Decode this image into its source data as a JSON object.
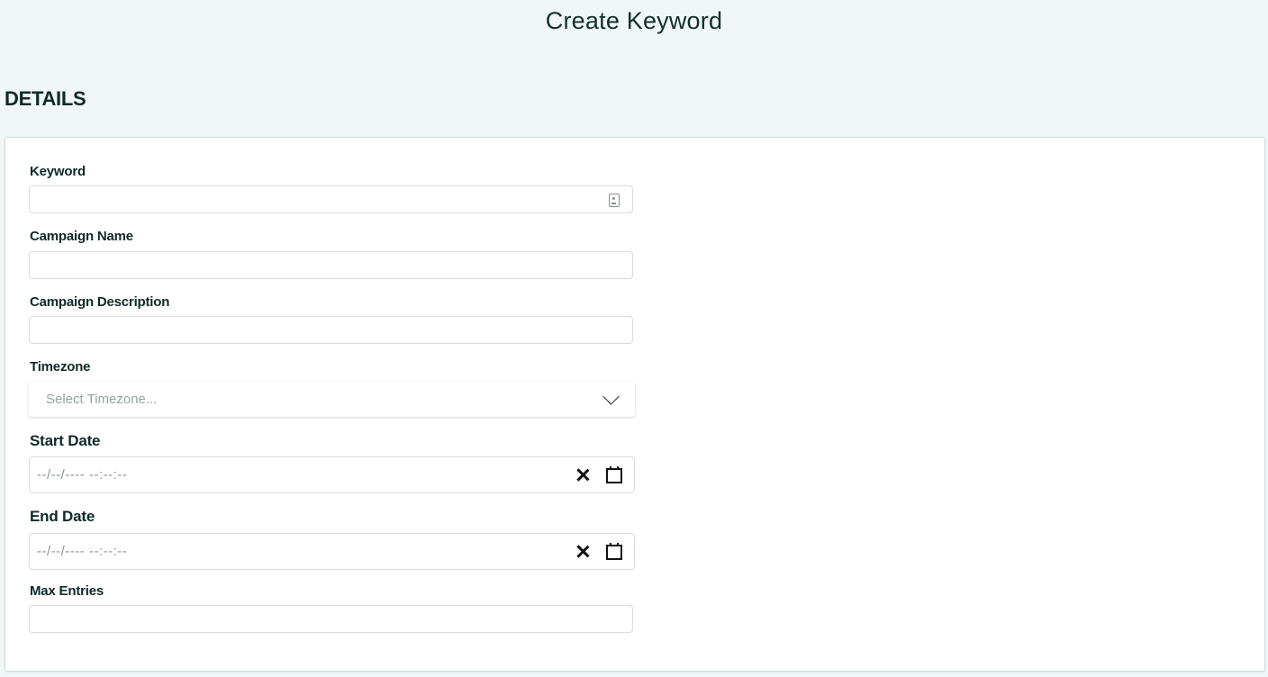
{
  "page": {
    "title": "Create Keyword",
    "section_heading": "DETAILS"
  },
  "form": {
    "keyword": {
      "label": "Keyword",
      "value": ""
    },
    "campaign_name": {
      "label": "Campaign Name",
      "value": ""
    },
    "campaign_description": {
      "label": "Campaign Description",
      "value": ""
    },
    "timezone": {
      "label": "Timezone",
      "placeholder": "Select Timezone..."
    },
    "start_date": {
      "label": "Start Date",
      "placeholder": "--/--/---- --:--:--"
    },
    "end_date": {
      "label": "End Date",
      "placeholder": "--/--/---- --:--:--"
    },
    "max_entries": {
      "label": "Max Entries",
      "value": ""
    }
  },
  "icons": {
    "keyword_field_icon": "contact-card-icon",
    "timezone_dropdown": "chevron-down-icon",
    "date_clear": "close-icon",
    "date_picker": "calendar-icon"
  },
  "colors": {
    "page_background": "#f1f7f6",
    "card_background": "#ffffff",
    "text_primary": "#0f2a26",
    "placeholder": "#9aa2a1"
  }
}
